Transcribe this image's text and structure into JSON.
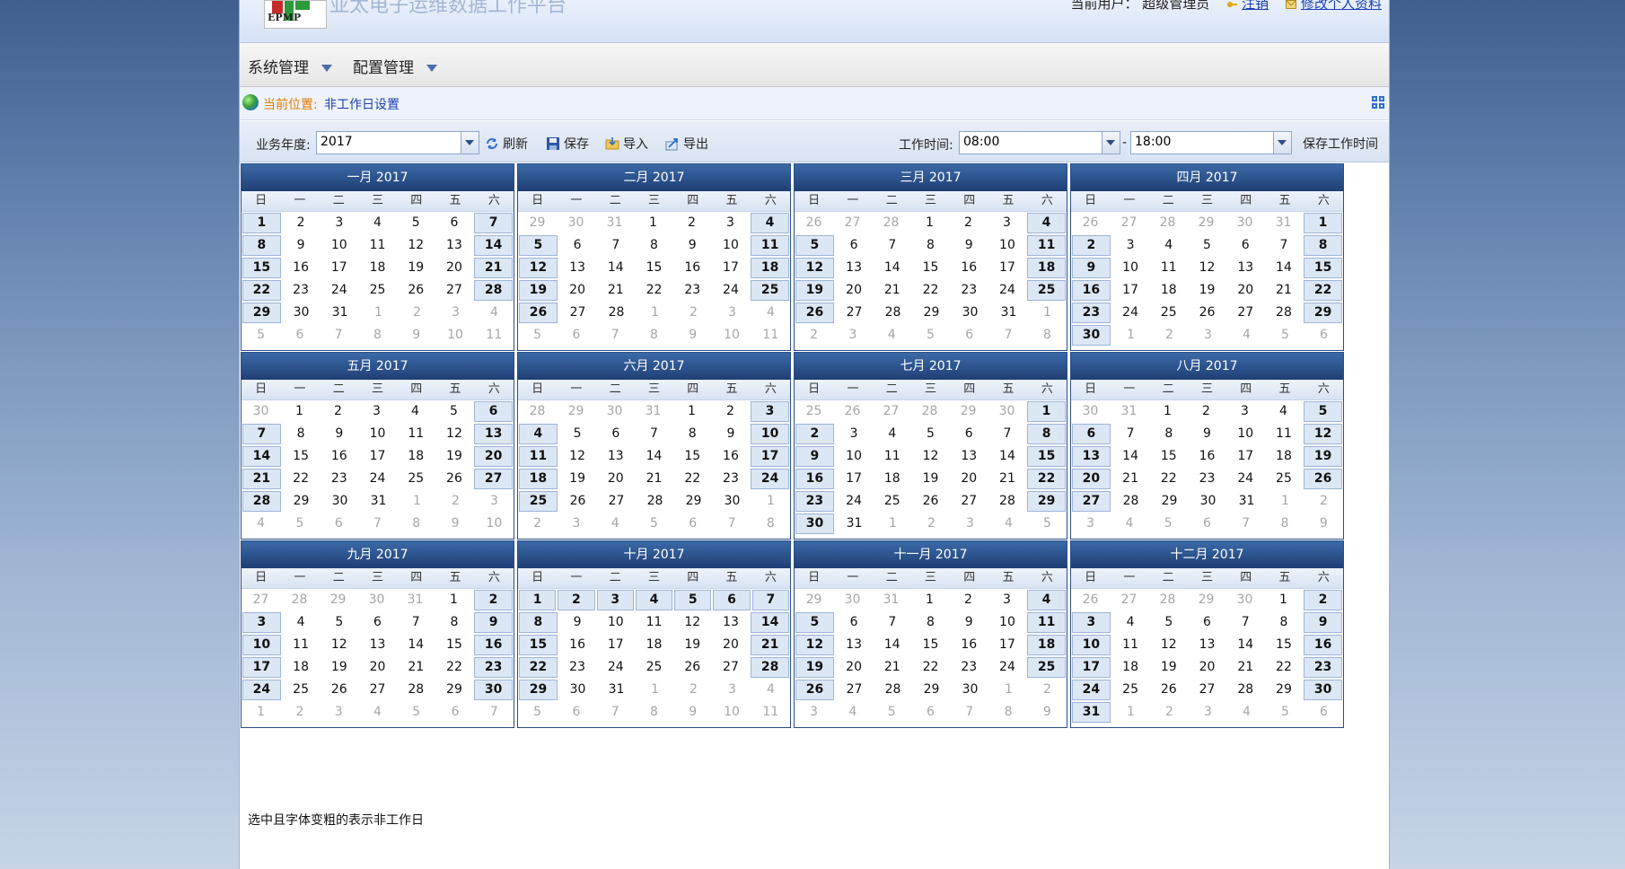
{
  "header": {
    "logo_text": "EPMP",
    "system_title": "亚太电子运维数据工作平台",
    "current_user_label": "当前用户：",
    "current_user": "超级管理员",
    "logout_label": "注销",
    "edit_profile_label": "修改个人资料"
  },
  "menu": {
    "items": [
      {
        "label": "系统管理"
      },
      {
        "label": "配置管理"
      }
    ]
  },
  "location": {
    "label": "当前位置:",
    "value": "非工作日设置"
  },
  "toolbar": {
    "year_label": "业务年度:",
    "year_value": "2017",
    "refresh_label": "刷新",
    "save_label": "保存",
    "import_label": "导入",
    "export_label": "导出",
    "worktime_label": "工作时间:",
    "start_time": "08:00",
    "separator": "-",
    "end_time": "18:00",
    "save_worktime_label": "保存工作时间"
  },
  "calendar": {
    "weekdays": [
      "日",
      "一",
      "二",
      "三",
      "四",
      "五",
      "六"
    ],
    "months": [
      {
        "title": "一月 2017",
        "first_dow": 0,
        "days": 31,
        "prev_days": 31,
        "extra_nonworking": []
      },
      {
        "title": "二月 2017",
        "first_dow": 3,
        "days": 28,
        "prev_days": 31,
        "extra_nonworking": []
      },
      {
        "title": "三月 2017",
        "first_dow": 3,
        "days": 31,
        "prev_days": 28,
        "extra_nonworking": []
      },
      {
        "title": "四月 2017",
        "first_dow": 6,
        "days": 30,
        "prev_days": 31,
        "extra_nonworking": []
      },
      {
        "title": "五月 2017",
        "first_dow": 1,
        "days": 31,
        "prev_days": 30,
        "extra_nonworking": []
      },
      {
        "title": "六月 2017",
        "first_dow": 4,
        "days": 30,
        "prev_days": 31,
        "extra_nonworking": []
      },
      {
        "title": "七月 2017",
        "first_dow": 6,
        "days": 31,
        "prev_days": 30,
        "extra_nonworking": []
      },
      {
        "title": "八月 2017",
        "first_dow": 2,
        "days": 31,
        "prev_days": 31,
        "extra_nonworking": []
      },
      {
        "title": "九月 2017",
        "first_dow": 5,
        "days": 30,
        "prev_days": 31,
        "extra_nonworking": []
      },
      {
        "title": "十月 2017",
        "first_dow": 0,
        "days": 31,
        "prev_days": 30,
        "extra_nonworking": [
          2,
          3,
          4,
          5,
          6
        ]
      },
      {
        "title": "十一月 2017",
        "first_dow": 3,
        "days": 30,
        "prev_days": 31,
        "extra_nonworking": []
      },
      {
        "title": "十二月 2017",
        "first_dow": 5,
        "days": 31,
        "prev_days": 30,
        "extra_nonworking": []
      }
    ]
  },
  "note": "选中且字体变粗的表示非工作日",
  "colors": {
    "calendar_header": "#1f3f74",
    "nonworking_bg": "#dce7f5",
    "location_label": "#e07b00",
    "link": "#1d3fae"
  }
}
